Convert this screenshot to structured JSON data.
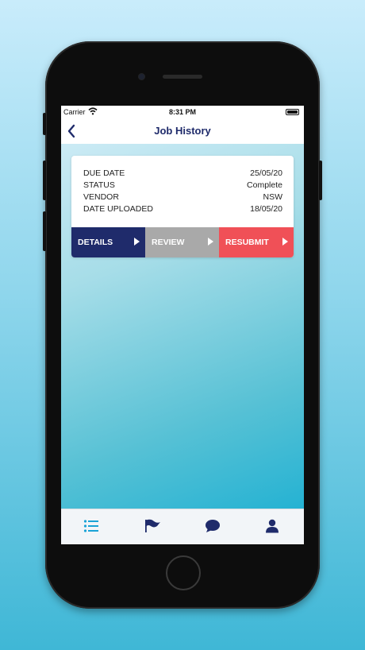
{
  "status_bar": {
    "carrier": "Carrier",
    "time": "8:31 PM"
  },
  "nav": {
    "title": "Job History",
    "back_icon": "chevron-left-icon"
  },
  "job_card": {
    "rows": [
      {
        "label": "DUE DATE",
        "value": "25/05/20"
      },
      {
        "label": "STATUS",
        "value": "Complete"
      },
      {
        "label": "VENDOR",
        "value": "NSW"
      },
      {
        "label": "DATE UPLOADED",
        "value": "18/05/20"
      }
    ],
    "actions": [
      {
        "label": "DETAILS",
        "color": "#1f2b6b"
      },
      {
        "label": "REVIEW",
        "color": "#a9a9a9"
      },
      {
        "label": "RESUBMIT",
        "color": "#f05057"
      }
    ]
  },
  "tab_bar": {
    "tabs": [
      {
        "icon": "list-icon",
        "active": true,
        "color": "#1aa3d6"
      },
      {
        "icon": "flag-icon",
        "active": false,
        "color": "#1f2b6b"
      },
      {
        "icon": "chat-icon",
        "active": false,
        "color": "#1f2b6b"
      },
      {
        "icon": "user-icon",
        "active": false,
        "color": "#1f2b6b"
      }
    ]
  },
  "colors": {
    "brand_navy": "#1f2b6b",
    "accent_red": "#f05057",
    "neutral_gray": "#a9a9a9"
  }
}
